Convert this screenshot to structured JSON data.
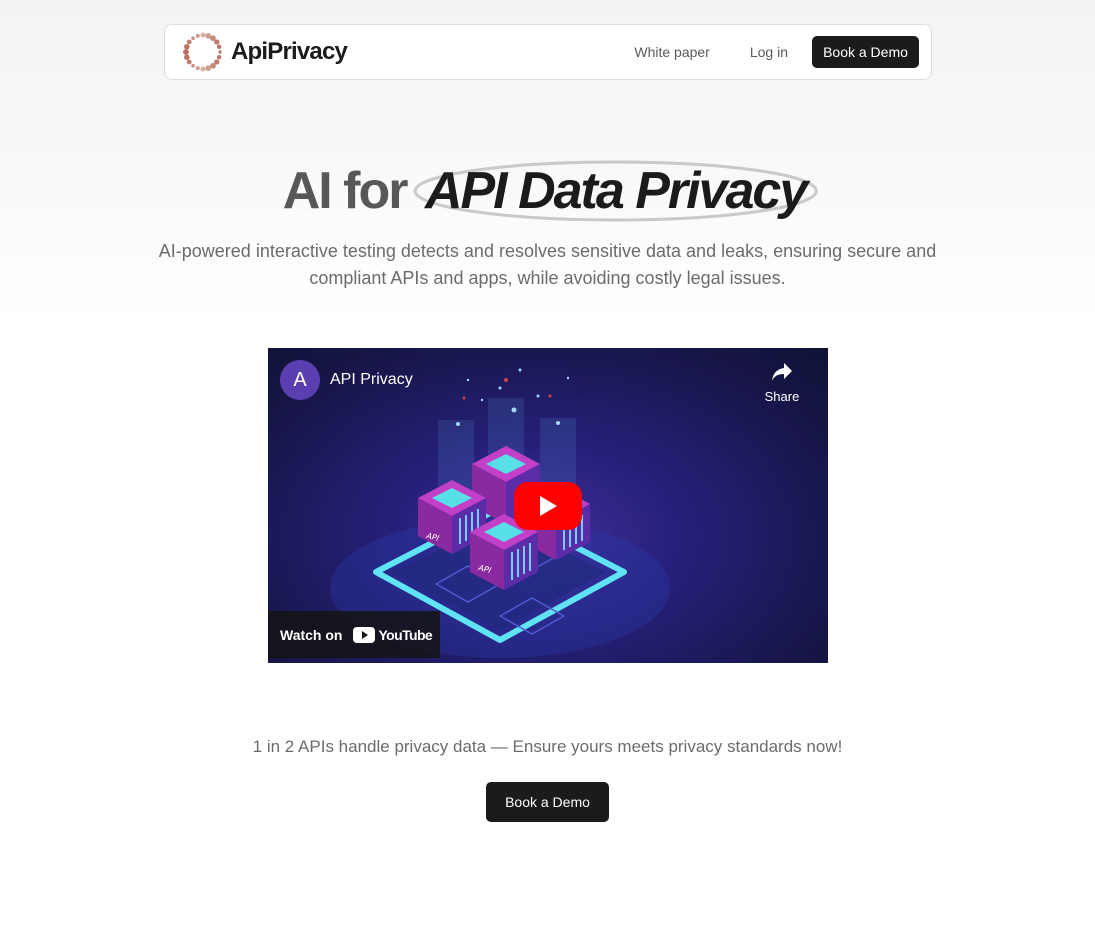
{
  "brand": {
    "name": "ApiPrivacy",
    "logo_icon": "dotted-ring-logo-icon",
    "accent": "#b96f5e"
  },
  "nav": {
    "white_paper": "White paper",
    "login": "Log in",
    "cta": "Book a Demo"
  },
  "hero": {
    "title_plain": "AI for",
    "title_emphasis": "API Data Privacy",
    "subtitle": "AI-powered interactive testing detects and resolves sensitive data and leaks, ensuring secure and compliant APIs and apps, while avoiding costly legal issues."
  },
  "video": {
    "channel_initial": "A",
    "channel_title": "API Privacy",
    "share_label": "Share",
    "watch_on": "Watch on",
    "platform": "YouTube",
    "thumbnail_labels": [
      "API",
      "API"
    ],
    "play_color": "#ff0000"
  },
  "cta": {
    "text": "1 in 2 APIs handle privacy data — Ensure yours meets privacy standards now!",
    "button": "Book a Demo"
  }
}
